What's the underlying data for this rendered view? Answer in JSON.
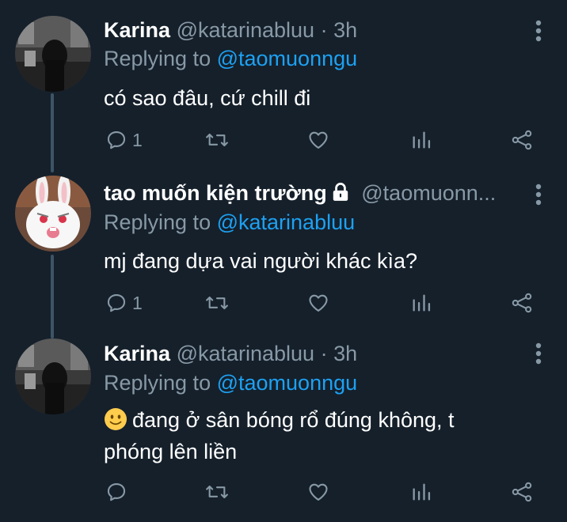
{
  "tweets": [
    {
      "name": "Karina",
      "handle": "@katarinabluu",
      "time": "· 3h",
      "replying_prefix": "Replying to",
      "replying_to": "@taomuonngu",
      "text": "có sao đâu, cứ chill đi",
      "reply_count": "1"
    },
    {
      "name": "tao muốn kiện trường",
      "handle": "@taomuonn...",
      "replying_prefix": "Replying to",
      "replying_to": "@katarinabluu",
      "text": "mj đang dựa vai người khác kìa?",
      "reply_count": "1"
    },
    {
      "name": "Karina",
      "handle": "@katarinabluu",
      "time": "· 3h",
      "replying_prefix": "Replying to",
      "replying_to": "@taomuonngu",
      "text_line1": "đang ở sân bóng rổ đúng không, t",
      "text_line2": "phóng lên liền",
      "reply_count": ""
    }
  ],
  "icons": {
    "reply": "reply-icon",
    "retweet": "retweet-icon",
    "like": "heart-icon",
    "analytics": "analytics-icon",
    "share": "share-icon",
    "more": "more-vertical-icon",
    "lock": "lock-icon",
    "emoji": "slightly-smiling-face-emoji"
  },
  "colors": {
    "background": "#15202b",
    "secondary_text": "#8899a6",
    "link": "#1da1f2",
    "thread_line": "#3d5466"
  }
}
